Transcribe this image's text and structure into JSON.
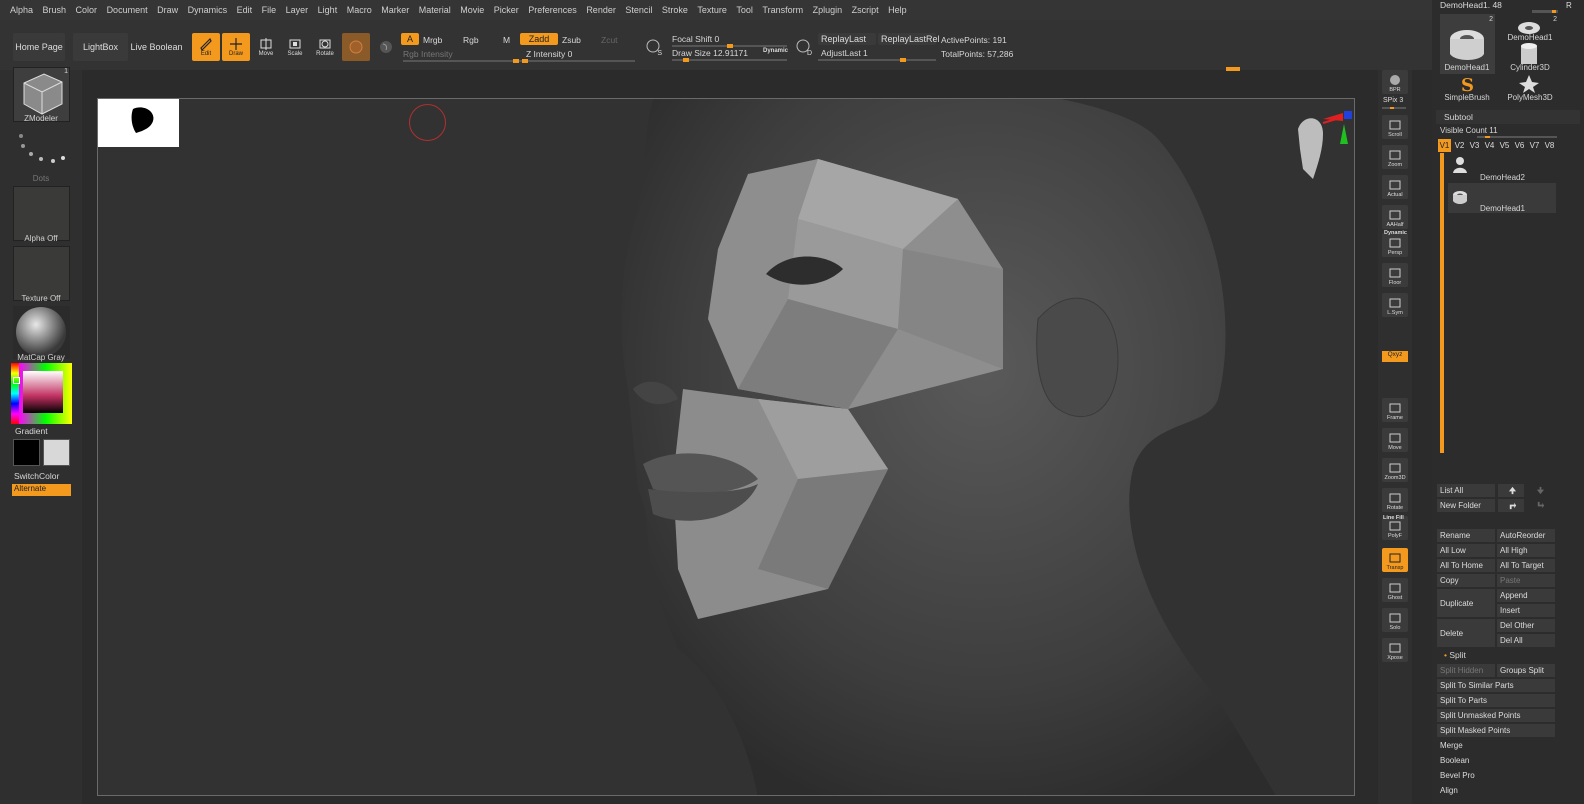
{
  "menu": [
    "Alpha",
    "Brush",
    "Color",
    "Document",
    "Draw",
    "Dynamics",
    "Edit",
    "File",
    "Layer",
    "Light",
    "Macro",
    "Marker",
    "Material",
    "Movie",
    "Picker",
    "Preferences",
    "Render",
    "Stencil",
    "Stroke",
    "Texture",
    "Tool",
    "Transform",
    "Zplugin",
    "Zscript",
    "Help"
  ],
  "toolbar": {
    "home_page": "Home Page",
    "lightbox": "LightBox",
    "live_boolean": "Live Boolean",
    "edit": "Edit",
    "draw": "Draw",
    "move": "Move",
    "scale": "Scale",
    "rotate": "Rotate",
    "a": "A",
    "mrgb": "Mrgb",
    "rgb": "Rgb",
    "m": "M",
    "rgb_intensity": "Rgb Intensity",
    "zadd": "Zadd",
    "zsub": "Zsub",
    "zcut": "Zcut",
    "z_intensity": "Z Intensity 0",
    "focal_shift": "Focal Shift 0",
    "draw_size": "Draw Size 12.91171",
    "dynamic": "Dynamic",
    "replay_last": "ReplayLast",
    "replay_last_rel": "ReplayLastRel",
    "adjust_last": "AdjustLast 1",
    "active_points": "ActivePoints: 191",
    "total_points": "TotalPoints: 57,286",
    "s_key": "S",
    "d_key": "D"
  },
  "left_shelf": {
    "zmodeler": "ZModeler",
    "zmodeler_badge": "1",
    "dots": "Dots",
    "alpha_off": "Alpha Off",
    "texture_off": "Texture Off",
    "matcap": "MatCap Gray",
    "gradient": "Gradient",
    "switch_color": "SwitchColor",
    "alternate": "Alternate"
  },
  "right_shelf": {
    "bpr": "BPR",
    "spix": "SPix 3",
    "buttons": [
      "Scroll",
      "Zoom",
      "Actual",
      "AAHalf",
      "Persp",
      "Floor",
      "L.Sym",
      "",
      "",
      "",
      "",
      "Frame",
      "Move",
      "Zoom3D",
      "Rotate",
      "PolyF",
      "Transp",
      "Ghost",
      "Solo",
      "Xpose"
    ],
    "dynamic": "Dynamic",
    "xyz": "Qxyz",
    "line_fill": "Line Fill"
  },
  "tool_panel": {
    "current_tool": "DemoHead1. 48",
    "r_label": "R",
    "tools": [
      {
        "name": "DemoHead1",
        "badge": "2"
      },
      {
        "name": "DemoHead1",
        "badge": "2"
      },
      {
        "name": "Cylinder3D",
        "badge": ""
      },
      {
        "name": "SimpleBrush",
        "badge": ""
      },
      {
        "name": "PolyMesh3D",
        "badge": ""
      }
    ]
  },
  "subtool": {
    "title": "Subtool",
    "visible_count": "Visible Count 11",
    "tabs": [
      "V1",
      "V2",
      "V3",
      "V4",
      "V5",
      "V6",
      "V7",
      "V8"
    ],
    "items": [
      "DemoHead2",
      "DemoHead1"
    ],
    "list_all": "List All",
    "new_folder": "New Folder",
    "rename": "Rename",
    "auto_reorder": "AutoReorder",
    "all_low": "All Low",
    "all_high": "All High",
    "all_to_home": "All To Home",
    "all_to_target": "All To Target",
    "copy": "Copy",
    "paste": "Paste",
    "duplicate": "Duplicate",
    "append": "Append",
    "insert": "Insert",
    "delete": "Delete",
    "del_other": "Del Other",
    "del_all": "Del All",
    "split": "Split",
    "split_hidden": "Split Hidden",
    "groups_split": "Groups Split",
    "split_similar": "Split To Similar Parts",
    "split_parts": "Split To Parts",
    "split_unmasked": "Split Unmasked Points",
    "split_masked": "Split Masked Points",
    "merge": "Merge",
    "boolean": "Boolean",
    "bevel_pro": "Bevel Pro",
    "align": "Align"
  },
  "colors": {
    "accent": "#f39a1e",
    "bg": "#2b2b2b",
    "panel": "#353535"
  }
}
